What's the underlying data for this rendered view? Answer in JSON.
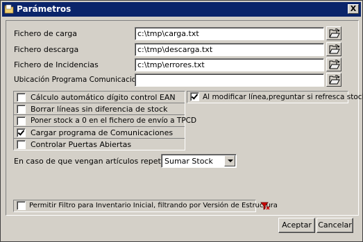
{
  "window": {
    "title": "Parámetros",
    "close_label": "X"
  },
  "files": [
    {
      "label": "Fichero de carga",
      "value": "c:\\tmp\\carga.txt"
    },
    {
      "label": "Fichero descarga",
      "value": "c:\\tmp\\descarga.txt"
    },
    {
      "label": "Fichero de Incidencias",
      "value": "c:\\tmp\\errores.txt"
    },
    {
      "label": "Ubicación Programa Comunicaciones",
      "value": ""
    }
  ],
  "options": [
    {
      "label": "Cálculo automático dígito control EAN",
      "checked": false
    },
    {
      "label": "Borrar líneas sin diferencia de stock",
      "checked": false
    },
    {
      "label": "Poner stock a 0 en el fichero de envío a TPCD",
      "checked": false
    },
    {
      "label": "Cargar programa de Comunicaciones",
      "checked": true
    },
    {
      "label": "Controlar Puertas Abiertas",
      "checked": false
    }
  ],
  "right_option": {
    "label": "Al modificar línea,preguntar si refresca stock.",
    "checked": true
  },
  "repeated": {
    "label": "En caso de que vengan artículos repetidos",
    "selected": "Sumar Stock"
  },
  "filter_option": {
    "label": "Permitir Filtro para Inventario Inicial, filtrando por Versión de Estructura",
    "checked": false
  },
  "buttons": {
    "accept": "Aceptar",
    "cancel": "Cancelar"
  },
  "colors": {
    "titlebar": "#0a246a",
    "face": "#d4d0c8",
    "filter_icon": "#cc0000"
  },
  "icons": {
    "window": "folder-icon",
    "browse": "open-folder-icon",
    "filter": "funnel-icon"
  }
}
